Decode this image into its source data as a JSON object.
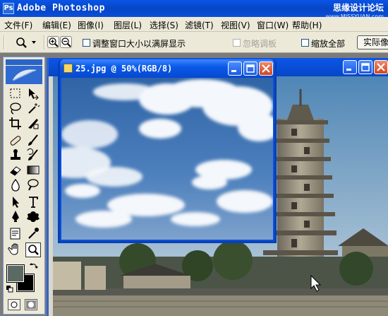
{
  "app": {
    "title": "Adobe Photoshop",
    "icon": "photoshop-app-icon",
    "watermark_cn": "思缘设计论坛",
    "watermark_url": "www.MISSYUAN.com"
  },
  "menu": [
    {
      "label": "文件(F)",
      "id": "file"
    },
    {
      "label": "编辑(E)",
      "id": "edit"
    },
    {
      "label": "图像(I)",
      "id": "image"
    },
    {
      "label": "图层(L)",
      "id": "layer"
    },
    {
      "label": "选择(S)",
      "id": "select"
    },
    {
      "label": "滤镜(T)",
      "id": "filter"
    },
    {
      "label": "视图(V)",
      "id": "view"
    },
    {
      "label": "窗口(W)",
      "id": "window"
    },
    {
      "label": "帮助(H)",
      "id": "help"
    }
  ],
  "options": {
    "tool_icon": "zoom-tool-icon",
    "zoom_in_icon": "zoom-in-icon",
    "zoom_out_icon": "zoom-out-icon",
    "resize_windows_label": "调整窗口大小以满屏显示",
    "ignore_palettes_label": "忽略调板",
    "zoom_all_label": "缩放全部",
    "actual_pixels_label": "实际像素"
  },
  "toolbox": {
    "tools": [
      "rectangular-marquee-tool-icon",
      "move-tool-icon",
      "lasso-tool-icon",
      "magic-wand-tool-icon",
      "crop-tool-icon",
      "slice-tool-icon",
      "healing-brush-tool-icon",
      "brush-tool-icon",
      "clone-stamp-tool-icon",
      "history-brush-tool-icon",
      "eraser-tool-icon",
      "gradient-tool-icon",
      "blur-tool-icon",
      "dodge-tool-icon",
      "path-selection-tool-icon",
      "type-tool-icon",
      "pen-tool-icon",
      "custom-shape-tool-icon",
      "notes-tool-icon",
      "eyedropper-tool-icon",
      "hand-tool-icon",
      "zoom-tool-icon"
    ],
    "active_tool": "zoom-tool-icon",
    "foreground_color": "#5b6a63",
    "background_color": "#000000"
  },
  "documents": {
    "active": {
      "title": "25.jpg @ 50%(RGB/8)"
    }
  },
  "colors": {
    "title_bar": "#0a4fd8",
    "chrome": "#ece9d8",
    "close_button": "#d4451e",
    "workspace": "#7b7b7b"
  }
}
